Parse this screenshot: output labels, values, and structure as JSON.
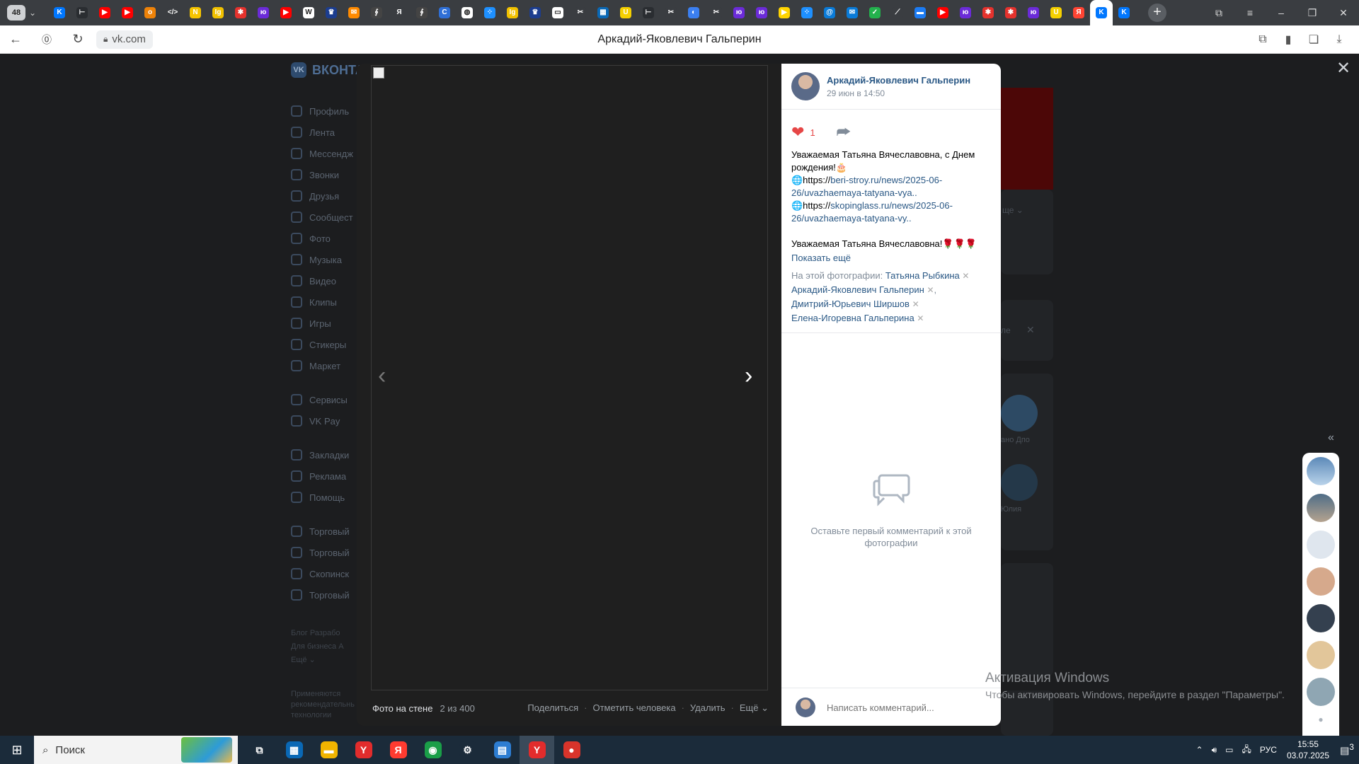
{
  "browser": {
    "tab_count": "48",
    "page_title": "Аркадий-Яковлевич Гальперин",
    "url": "vk.com",
    "tab_icons": [
      {
        "name": "vk",
        "color": "#0077ff",
        "glyph": "K"
      },
      {
        "name": "task",
        "color": "#2a2d31",
        "glyph": "⊢"
      },
      {
        "name": "youtube",
        "color": "#ff0000",
        "glyph": "▶"
      },
      {
        "name": "youtube",
        "color": "#ff0000",
        "glyph": "▶"
      },
      {
        "name": "ok",
        "color": "#ee8208",
        "glyph": "о"
      },
      {
        "name": "code",
        "color": "#3a3d41",
        "glyph": "</>"
      },
      {
        "name": "n",
        "color": "#f5c400",
        "glyph": "N"
      },
      {
        "name": "l",
        "color": "#f2c200",
        "glyph": "Ig"
      },
      {
        "name": "huawei",
        "color": "#e5322d",
        "glyph": "✱"
      },
      {
        "name": "purple",
        "color": "#6b2bd8",
        "glyph": "ю"
      },
      {
        "name": "youtube",
        "color": "#ff0000",
        "glyph": "▶"
      },
      {
        "name": "wiki",
        "color": "#ffffff",
        "glyph": "W"
      },
      {
        "name": "gov",
        "color": "#1c3d8f",
        "glyph": "♛"
      },
      {
        "name": "mail",
        "color": "#ff8a00",
        "glyph": "✉"
      },
      {
        "name": "spin",
        "color": "#444",
        "glyph": "∮"
      },
      {
        "name": "yandex",
        "color": "#3a3d41",
        "glyph": "Я"
      },
      {
        "name": "spin",
        "color": "#444",
        "glyph": "∮"
      },
      {
        "name": "c",
        "color": "#2f6fd6",
        "glyph": "C"
      },
      {
        "name": "compass",
        "color": "#ffffff",
        "glyph": "◍"
      },
      {
        "name": "dots",
        "color": "#1e90ff",
        "glyph": "⁘"
      },
      {
        "name": "l",
        "color": "#f2c200",
        "glyph": "Ig"
      },
      {
        "name": "gov",
        "color": "#1c3d8f",
        "glyph": "♛"
      },
      {
        "name": "doc",
        "color": "#ffffff",
        "glyph": "▭"
      },
      {
        "name": "scissors",
        "color": "#3a3d41",
        "glyph": "✂"
      },
      {
        "name": "news",
        "color": "#0a68b5",
        "glyph": "▦"
      },
      {
        "name": "u",
        "color": "#f5d000",
        "glyph": "U"
      },
      {
        "name": "task",
        "color": "#2a2d31",
        "glyph": "⊢"
      },
      {
        "name": "scissors",
        "color": "#3a3d41",
        "glyph": "✂"
      },
      {
        "name": "globe",
        "color": "#3b7ff0",
        "glyph": "◐"
      },
      {
        "name": "scissors",
        "color": "#3a3d41",
        "glyph": "✂"
      },
      {
        "name": "purple",
        "color": "#6b2bd8",
        "glyph": "ю"
      },
      {
        "name": "purple",
        "color": "#6b2bd8",
        "glyph": "ю"
      },
      {
        "name": "play",
        "color": "#ffd400",
        "glyph": "▶"
      },
      {
        "name": "dots",
        "color": "#1e90ff",
        "glyph": "⁘"
      },
      {
        "name": "at",
        "color": "#0a7bd8",
        "glyph": "@"
      },
      {
        "name": "mail",
        "color": "#0a7bd8",
        "glyph": "✉"
      },
      {
        "name": "check",
        "color": "#23b14d",
        "glyph": "✓"
      },
      {
        "name": "green",
        "color": "#3a3d41",
        "glyph": "⟋"
      },
      {
        "name": "chat",
        "color": "#1c7cf4",
        "glyph": "▬"
      },
      {
        "name": "youtube",
        "color": "#ff0000",
        "glyph": "▶"
      },
      {
        "name": "purple",
        "color": "#6b2bd8",
        "glyph": "ю"
      },
      {
        "name": "huawei",
        "color": "#e5322d",
        "glyph": "✱"
      },
      {
        "name": "huawei",
        "color": "#e5322d",
        "glyph": "✱"
      },
      {
        "name": "purple",
        "color": "#6b2bd8",
        "glyph": "ю"
      },
      {
        "name": "u",
        "color": "#f5d000",
        "glyph": "U"
      },
      {
        "name": "yandex",
        "color": "#ff4433",
        "glyph": "Я"
      },
      {
        "name": "vk",
        "color": "#0077ff",
        "glyph": "K"
      },
      {
        "name": "vk",
        "color": "#0077ff",
        "glyph": "K"
      }
    ]
  },
  "vk": {
    "logo": "ВКОНТА",
    "sidebar": [
      "Профиль",
      "Лента",
      "Мессендж",
      "Звонки",
      "Друзья",
      "Сообщест",
      "Фото",
      "Музыка",
      "Видео",
      "Клипы",
      "Игры",
      "Стикеры",
      "Маркет",
      "Сервисы",
      "VK Pay",
      "Закладки",
      "Реклама",
      "Помощь",
      "Торговый",
      "Торговый",
      "Скопинск",
      "Торговый"
    ],
    "footer_links": [
      "Блог  Разрабо",
      "Для бизнеса  А",
      "Ещё ⌄"
    ],
    "footer_note": "Применяются рекомендательные технологии",
    "bg_labels": [
      "ще ⌄",
      "ле",
      "ано Дпо",
      "Юлия"
    ]
  },
  "viewer": {
    "photo_label": "Фото на стене",
    "photo_counter": "2 из 400",
    "actions": [
      "Поделиться",
      "Отметить человека",
      "Удалить",
      "Ещё ⌄"
    ],
    "author": "Аркадий-Яковлевич Гальперин",
    "date": "29 июн в 14:50",
    "likes": "1",
    "post": {
      "line1": "Уважаемая Татьяна Вячеславовна, с Днем рождения!🎂",
      "link1_prefix": "🌐https://",
      "link1": "beri-stroy.ru/news/2025-06-26/uvazhaemaya-tatyana-vya..",
      "link2_prefix": "🌐https://",
      "link2": "skopinglass.ru/news/2025-06-26/uvazhaemaya-tatyana-vy..",
      "line2": "Уважаемая Татьяна Вячеславовна!🌹🌹🌹",
      "show_more": "Показать ещё"
    },
    "tags_label": "На этой фотографии:",
    "tags": [
      "Татьяна Рыбкина",
      "Аркадий-Яковлевич Гальперин",
      "Дмитрий-Юрьевич Ширшов",
      "Елена-Игоревна Гальперина"
    ],
    "empty_comments": "Оставьте первый комментарий к этой фотографии",
    "comment_placeholder": "Написать комментарий..."
  },
  "windows": {
    "activation_title": "Активация Windows",
    "activation_text": "Чтобы активировать Windows, перейдите в раздел \"Параметры\".",
    "search": "Поиск",
    "lang": "РУС",
    "time": "15:55",
    "date": "03.07.2025",
    "notifications": "3",
    "apps": [
      {
        "name": "task-view",
        "color": "#1b2b3a",
        "glyph": "⧉"
      },
      {
        "name": "store",
        "color": "#0a68b5",
        "glyph": "▦"
      },
      {
        "name": "explorer",
        "color": "#f0b400",
        "glyph": "▬"
      },
      {
        "name": "yandex-browser",
        "color": "#e22c2c",
        "glyph": "Y"
      },
      {
        "name": "yandex",
        "color": "#ff3b30",
        "glyph": "Я"
      },
      {
        "name": "chrome",
        "color": "#1a9e48",
        "glyph": "◉"
      },
      {
        "name": "settings",
        "color": "#1b2b3a",
        "glyph": "⚙"
      },
      {
        "name": "news-app",
        "color": "#2d7dd2",
        "glyph": "▤"
      },
      {
        "name": "yandex-browser-active",
        "color": "#e22c2c",
        "glyph": "Y"
      },
      {
        "name": "color-app",
        "color": "#d8342b",
        "glyph": "●"
      }
    ]
  }
}
